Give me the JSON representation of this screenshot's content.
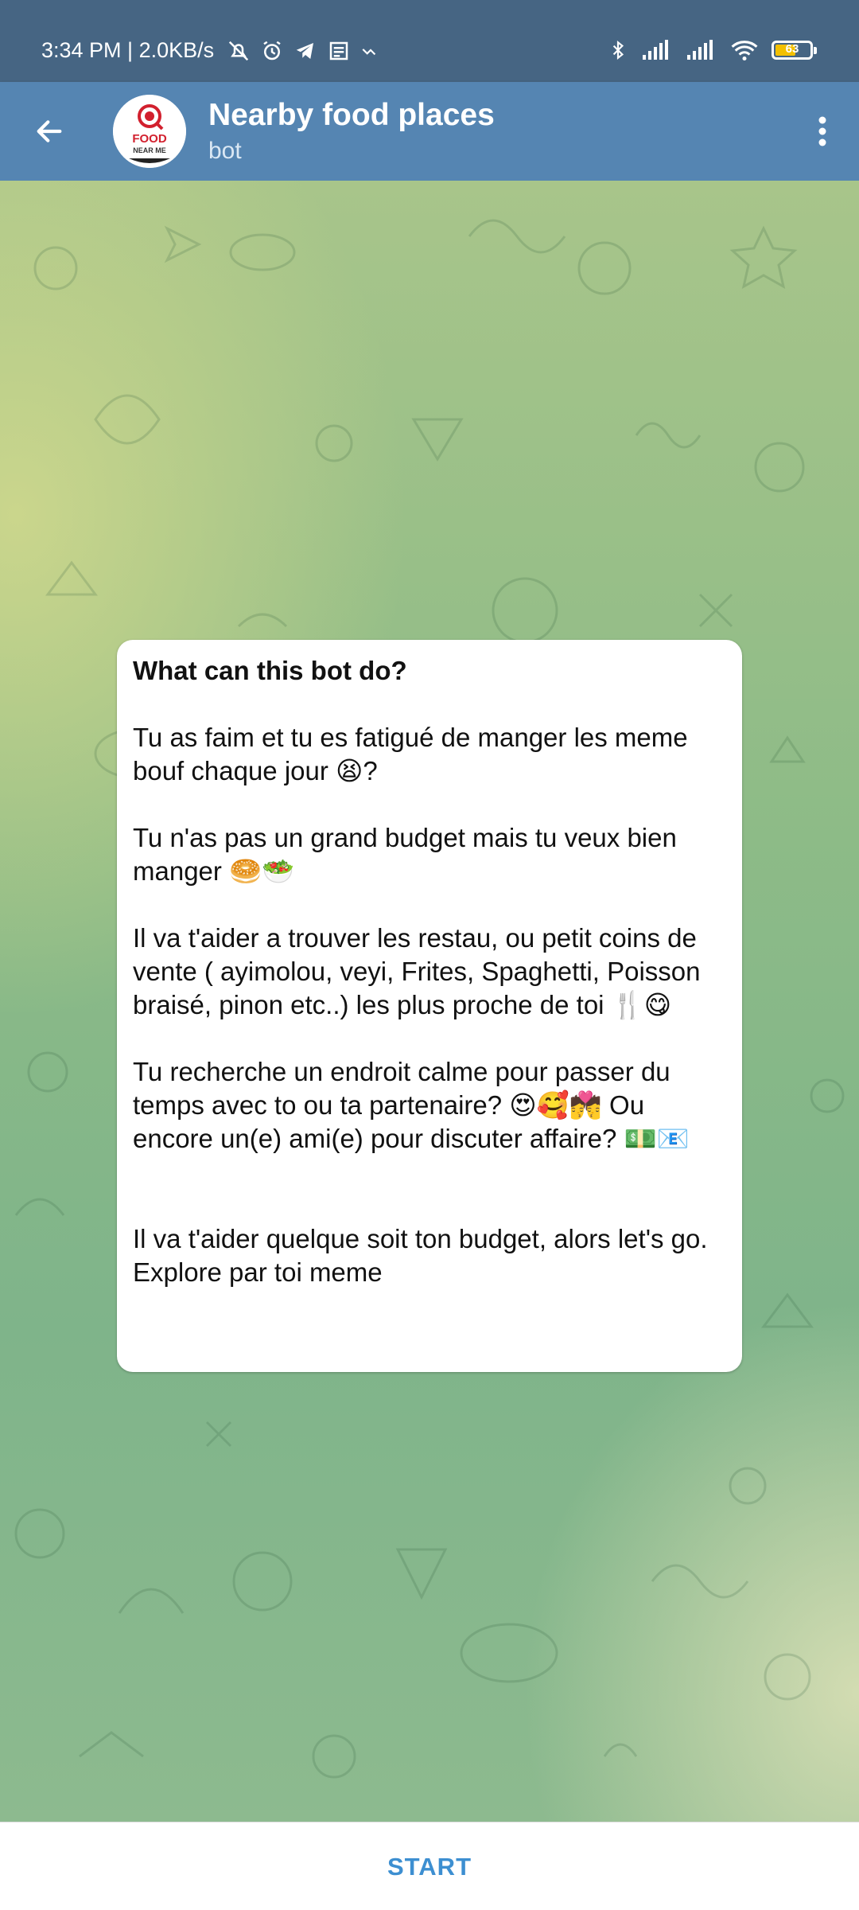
{
  "status_bar": {
    "time_speed": "3:34 PM | 2.0KB/s",
    "battery_level": "63",
    "battery_fraction": 0.63
  },
  "header": {
    "title": "Nearby food places",
    "subtitle": "bot",
    "avatar_text_top": "FOOD",
    "avatar_text_bottom": "NEAR ME"
  },
  "bot_info": {
    "title": "What can this bot do?",
    "paragraphs": [
      "Tu as faim et tu es fatigué de manger les meme bouf chaque jour 😫?",
      "Tu n'as pas un grand budget mais tu veux bien manger 🥯🥗",
      "Il va t'aider a trouver les restau, ou petit coins de vente ( ayimolou, veyi, Frites, Spaghetti, Poisson braisé, pinon etc..) les plus proche de toi 🍴😋",
      "Tu recherche un endroit calme pour passer du temps avec to ou ta partenaire? 😍🥰💏 Ou encore un(e) ami(e) pour discuter affaire? 💵📧",
      "Il va t'aider quelque soit ton budget, alors let's go. Explore par toi meme"
    ]
  },
  "bottom": {
    "start_label": "START"
  },
  "colors": {
    "status_bar": "#466583",
    "header": "#5585b2",
    "start_text": "#3d8fd1",
    "avatar_red": "#d2202e"
  }
}
